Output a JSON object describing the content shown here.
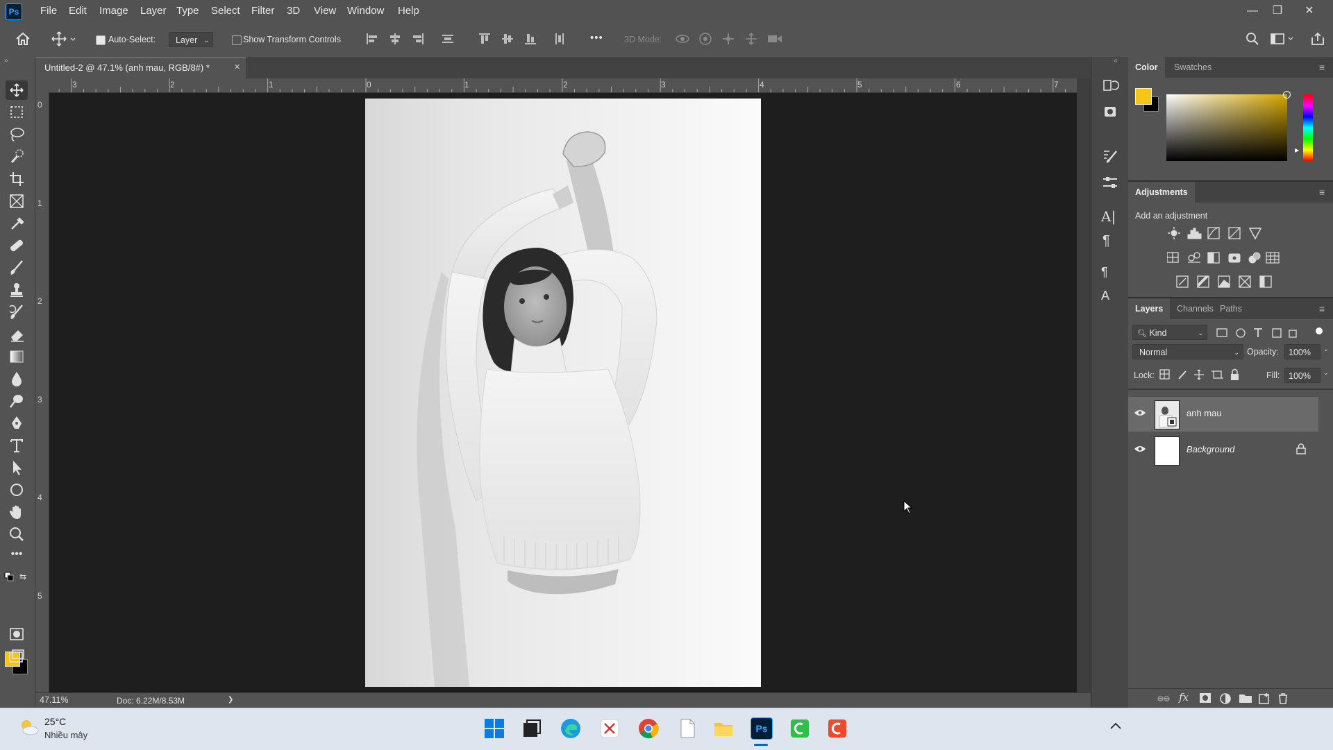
{
  "app": {
    "logo": "Ps",
    "name": "Adobe Photoshop"
  },
  "menu": [
    "File",
    "Edit",
    "Image",
    "Layer",
    "Type",
    "Select",
    "Filter",
    "3D",
    "View",
    "Window",
    "Help"
  ],
  "window_controls": {
    "minimize": "—",
    "restore": "❐",
    "close": "✕"
  },
  "options": {
    "auto_select_label": "Auto-Select:",
    "auto_select_checked": true,
    "auto_select_target": "Layer",
    "show_transform_label": "Show Transform Controls",
    "show_transform_checked": false,
    "more": "•••",
    "mode_3d_label": "3D Mode:"
  },
  "document": {
    "tab_title": "Untitled-2 @ 47.1% (anh mau, RGB/8#) *",
    "tab_close": "✕",
    "zoom": "47.11%",
    "doc_size": "Doc: 6.22M/8.53M",
    "status_arrow": "❯"
  },
  "rulers": {
    "horizontal": [
      "3",
      "2",
      "1",
      "0",
      "1",
      "2",
      "3",
      "4",
      "5",
      "6",
      "7"
    ],
    "vertical": [
      "0",
      "1",
      "2",
      "3",
      "4",
      "5"
    ]
  },
  "color_panel": {
    "tabs": [
      "Color",
      "Swatches"
    ],
    "active_tab": "Color",
    "foreground": "#f5c518",
    "background": "#000000",
    "picker_hue": "#d4a500"
  },
  "adjustments_panel": {
    "title": "Adjustments",
    "hint": "Add an adjustment"
  },
  "layers_panel": {
    "tabs": [
      "Layers",
      "Channels",
      "Paths"
    ],
    "active_tab": "Layers",
    "filter": "Kind",
    "blend_mode": "Normal",
    "opacity_label": "Opacity:",
    "opacity": "100%",
    "lock_label": "Lock:",
    "fill_label": "Fill:",
    "fill": "100%",
    "layers": [
      {
        "name": "anh mau",
        "visible": true,
        "selected": true,
        "locked": false
      },
      {
        "name": "Background",
        "visible": true,
        "selected": false,
        "locked": true
      }
    ]
  },
  "taskbar": {
    "weather_temp": "25°C",
    "weather_desc": "Nhiều mây"
  }
}
